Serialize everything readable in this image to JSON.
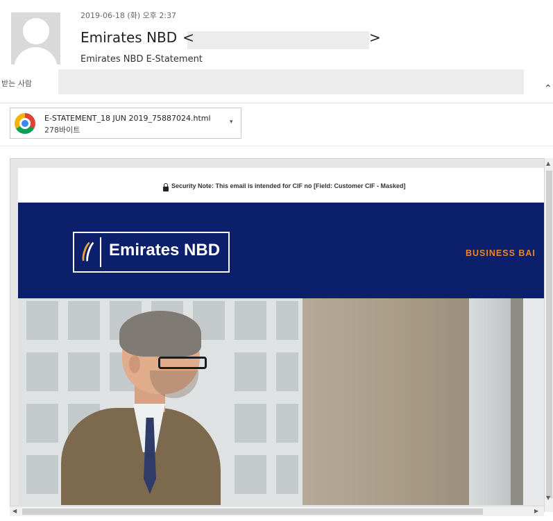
{
  "message": {
    "datetime": "2019-06-18 (화) 오후 2:37",
    "sender_name": "Emirates NBD",
    "sender_open": "<",
    "sender_close": ">",
    "subject": "Emirates NBD E-Statement",
    "to_label": "받는 사람"
  },
  "attachment": {
    "filename": "E-STATEMENT_18 JUN 2019_75887024.html",
    "size": "278바이트",
    "icon": "chrome-icon"
  },
  "email_body": {
    "security_note": "Security Note: This email is intended for CIF no [Field: Customer CIF - Masked]",
    "logo_text": "Emirates NBD",
    "banner_tagline": "BUSINESS BAI",
    "banner_color": "#0b1f6b",
    "accent_color": "#e8862a"
  },
  "scrollbars": {
    "up_arrow": "▲",
    "down_arrow": "▼",
    "left_arrow": "◀",
    "right_arrow": "▶"
  }
}
